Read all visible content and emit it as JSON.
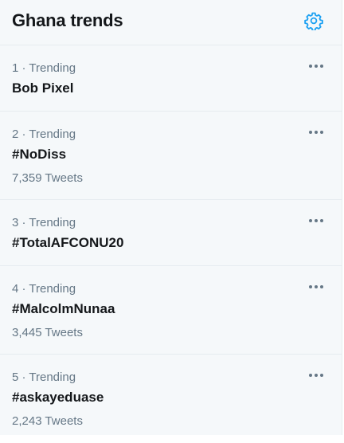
{
  "header": {
    "title": "Ghana trends",
    "settings_icon": "gear-icon",
    "accent_color": "#1da1f2"
  },
  "trends": [
    {
      "meta": "1 · Trending",
      "name": "Bob Pixel",
      "count": ""
    },
    {
      "meta": "2 · Trending",
      "name": "#NoDiss",
      "count": "7,359 Tweets"
    },
    {
      "meta": "3 · Trending",
      "name": "#TotalAFCONU20",
      "count": ""
    },
    {
      "meta": "4 · Trending",
      "name": "#MalcolmNunaa",
      "count": "3,445 Tweets"
    },
    {
      "meta": "5 · Trending",
      "name": "#askayeduase",
      "count": "2,243 Tweets"
    }
  ],
  "more_icon": "more-horizontal-icon"
}
